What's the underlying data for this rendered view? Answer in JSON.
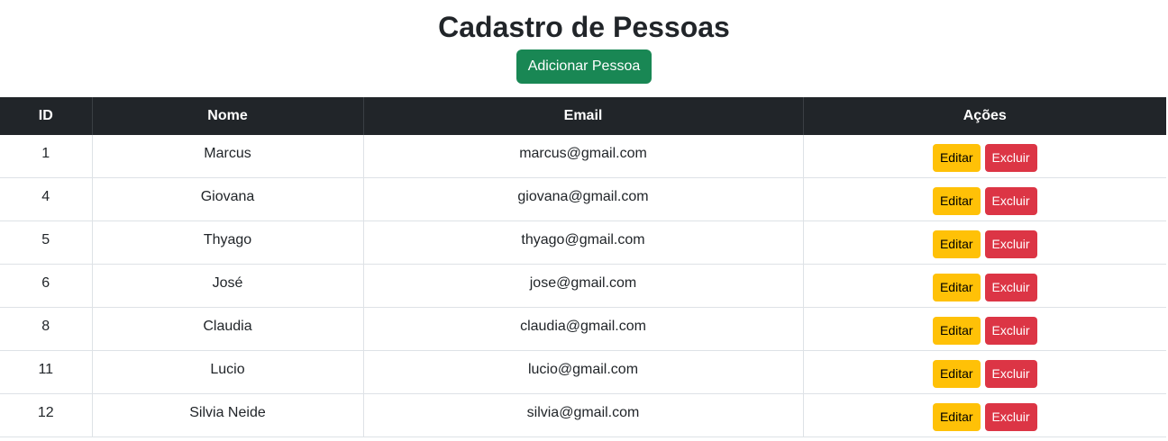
{
  "page": {
    "title": "Cadastro de Pessoas",
    "add_button_label": "Adicionar Pessoa"
  },
  "table": {
    "columns": [
      "ID",
      "Nome",
      "Email",
      "Ações"
    ],
    "rows": [
      {
        "id": "1",
        "name": "Marcus",
        "email": "marcus@gmail.com"
      },
      {
        "id": "4",
        "name": "Giovana",
        "email": "giovana@gmail.com"
      },
      {
        "id": "5",
        "name": "Thyago",
        "email": "thyago@gmail.com"
      },
      {
        "id": "6",
        "name": "José",
        "email": "jose@gmail.com"
      },
      {
        "id": "8",
        "name": "Claudia",
        "email": "claudia@gmail.com"
      },
      {
        "id": "11",
        "name": "Lucio",
        "email": "lucio@gmail.com"
      },
      {
        "id": "12",
        "name": "Silvia Neide",
        "email": "silvia@gmail.com"
      }
    ],
    "edit_label": "Editar",
    "delete_label": "Excluir"
  },
  "colors": {
    "add_button": "#198754",
    "header_bg": "#212529",
    "edit_button": "#ffc107",
    "delete_button": "#dc3545"
  }
}
